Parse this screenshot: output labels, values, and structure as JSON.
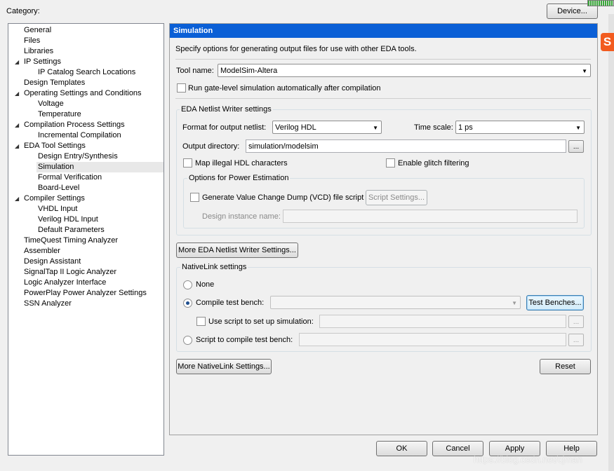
{
  "category_label": "Category:",
  "device_button": "Device...",
  "tree": [
    {
      "label": "General",
      "level": 0
    },
    {
      "label": "Files",
      "level": 0
    },
    {
      "label": "Libraries",
      "level": 0
    },
    {
      "label": "IP Settings",
      "level": 0,
      "expanded": true
    },
    {
      "label": "IP Catalog Search Locations",
      "level": 1
    },
    {
      "label": "Design Templates",
      "level": 0
    },
    {
      "label": "Operating Settings and Conditions",
      "level": 0,
      "expanded": true
    },
    {
      "label": "Voltage",
      "level": 1
    },
    {
      "label": "Temperature",
      "level": 1
    },
    {
      "label": "Compilation Process Settings",
      "level": 0,
      "expanded": true
    },
    {
      "label": "Incremental Compilation",
      "level": 1
    },
    {
      "label": "EDA Tool Settings",
      "level": 0,
      "expanded": true
    },
    {
      "label": "Design Entry/Synthesis",
      "level": 1
    },
    {
      "label": "Simulation",
      "level": 1,
      "selected": true
    },
    {
      "label": "Formal Verification",
      "level": 1
    },
    {
      "label": "Board-Level",
      "level": 1
    },
    {
      "label": "Compiler Settings",
      "level": 0,
      "expanded": true
    },
    {
      "label": "VHDL Input",
      "level": 1
    },
    {
      "label": "Verilog HDL Input",
      "level": 1
    },
    {
      "label": "Default Parameters",
      "level": 1
    },
    {
      "label": "TimeQuest Timing Analyzer",
      "level": 0
    },
    {
      "label": "Assembler",
      "level": 0
    },
    {
      "label": "Design Assistant",
      "level": 0
    },
    {
      "label": "SignalTap II Logic Analyzer",
      "level": 0
    },
    {
      "label": "Logic Analyzer Interface",
      "level": 0
    },
    {
      "label": "PowerPlay Power Analyzer Settings",
      "level": 0
    },
    {
      "label": "SSN Analyzer",
      "level": 0
    }
  ],
  "panel": {
    "title": "Simulation",
    "title_bg": "#0a5fd6",
    "description": "Specify options for generating output files for use with other EDA tools.",
    "tool_name_label": "Tool name:",
    "tool_name_value": "ModelSim-Altera",
    "run_gate_level_label": "Run gate-level simulation automatically after compilation",
    "netlist_group": {
      "title": "EDA Netlist Writer settings",
      "format_label": "Format for output netlist:",
      "format_value": "Verilog HDL",
      "time_scale_label": "Time scale:",
      "time_scale_value": "1 ps",
      "output_dir_label": "Output directory:",
      "output_dir_value": "simulation/modelsim",
      "browse_label": "...",
      "map_illegal_label": "Map illegal HDL characters",
      "glitch_label": "Enable glitch filtering",
      "power_group": {
        "title": "Options for Power Estimation",
        "vcd_label": "Generate Value Change Dump (VCD) file script",
        "script_settings_label": "Script Settings...",
        "instance_label": "Design instance name:",
        "instance_value": ""
      }
    },
    "more_netlist_button": "More EDA Netlist Writer Settings...",
    "nativelink_group": {
      "title": "NativeLink settings",
      "none_label": "None",
      "compile_tb_label": "Compile test bench:",
      "compile_tb_value": "",
      "test_benches_button": "Test Benches...",
      "use_script_label": "Use script to set up simulation:",
      "use_script_value": "",
      "script_compile_label": "Script to compile test bench:",
      "script_compile_value": "",
      "browse_label": "..."
    },
    "more_nativelink_button": "More NativeLink Settings...",
    "reset_button": "Reset"
  },
  "footer": {
    "ok": "OK",
    "cancel": "Cancel",
    "apply": "Apply",
    "help": "Help"
  },
  "watermark": "https://blog.csdn.net/cjman",
  "logo_text": "S"
}
